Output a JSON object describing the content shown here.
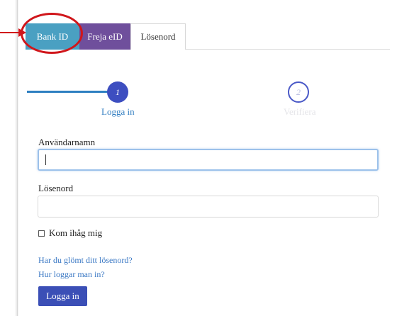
{
  "tabs": [
    {
      "label": "Bank ID",
      "active": true,
      "color": "#4aa0c2"
    },
    {
      "label": "Freja eID",
      "active": false,
      "color": "#6f4f9c"
    },
    {
      "label": "Lösenord",
      "active": false,
      "color": "#ffffff"
    }
  ],
  "stepper": {
    "steps": [
      {
        "number": "1",
        "label": "Logga in",
        "state": "active"
      },
      {
        "number": "2",
        "label": "Verifiera",
        "state": "pending"
      }
    ]
  },
  "form": {
    "username_label": "Användarnamn",
    "username_value": "",
    "password_label": "Lösenord",
    "password_value": "",
    "remember_label": "Kom ihåg mig",
    "remember_checked": false
  },
  "links": {
    "forgot": "Har du glömt ditt lösenord?",
    "how": "Hur loggar man in?"
  },
  "submit_label": "Logga in",
  "colors": {
    "accent": "#3b4fb6",
    "link": "#3a78c4",
    "annotation": "#d0161b"
  }
}
